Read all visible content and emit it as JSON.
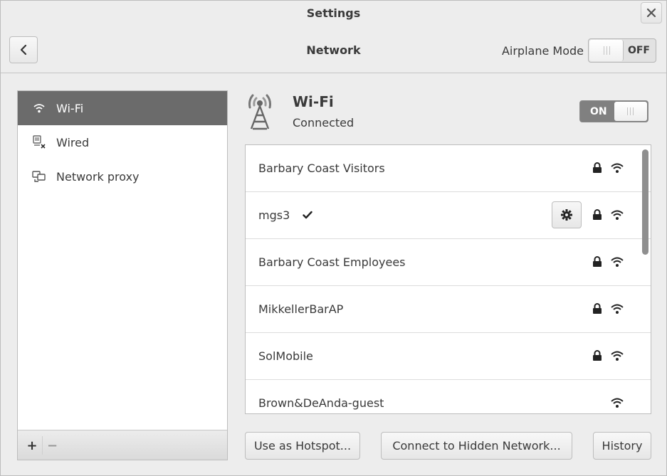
{
  "window": {
    "title": "Settings"
  },
  "header": {
    "title": "Network",
    "airplane_mode_label": "Airplane Mode",
    "airplane_mode_state": "OFF"
  },
  "sidebar": {
    "items": [
      {
        "label": "Wi-Fi",
        "icon": "wifi-icon",
        "selected": true
      },
      {
        "label": "Wired",
        "icon": "wired-icon",
        "selected": false
      },
      {
        "label": "Network proxy",
        "icon": "proxy-icon",
        "selected": false
      }
    ],
    "add_label": "+",
    "remove_label": "−"
  },
  "wifi": {
    "title": "Wi-Fi",
    "status": "Connected",
    "switch_state": "ON",
    "networks": [
      {
        "name": "Barbary Coast Visitors",
        "secured": true,
        "connected": false
      },
      {
        "name": "mgs3",
        "secured": true,
        "connected": true
      },
      {
        "name": "Barbary Coast Employees",
        "secured": true,
        "connected": false
      },
      {
        "name": "MikkellerBarAP",
        "secured": true,
        "connected": false
      },
      {
        "name": "SolMobile",
        "secured": true,
        "connected": false
      },
      {
        "name": "Brown&DeAnda-guest",
        "secured": false,
        "connected": false
      }
    ]
  },
  "buttons": {
    "hotspot": "Use as Hotspot...",
    "hidden_network": "Connect to Hidden Network...",
    "history": "History"
  },
  "colors": {
    "window_bg": "#ededed",
    "selection": "#6b6b6b",
    "switch_on": "#808080"
  }
}
